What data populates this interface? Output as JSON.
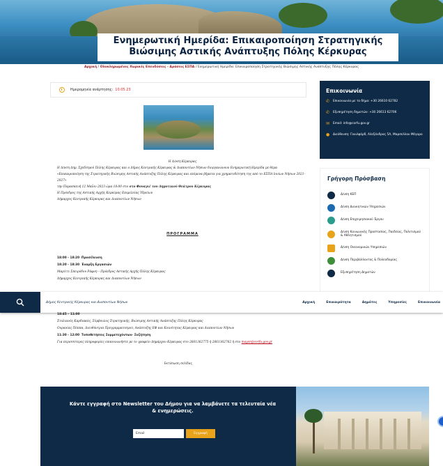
{
  "page": {
    "title": "Ενημερωτική Ημερίδα: Επικαιροποίηση Στρατηγικής Βιώσιμης Αστικής Ανάπτυξης Πόλης Κέρκυρας"
  },
  "breadcrumb": {
    "home": "Αρχική",
    "sep": " / ",
    "section": "Ολοκληρωμένες Χωρικές Επενδύσεις - Δράσεις ΕΣΠΑ",
    "current": "Ενημερωτική Ημερίδα: Επικαιροποίηση Στρατηγικής Βιώσιμης Αστικής Ανάπτυξης Πόλης Κέρκυρας"
  },
  "meta": {
    "date_label": "Ημερομηνία ανάρτησης:",
    "date_value": "10.05.23"
  },
  "article": {
    "intro_caption": "Η Δ/νση Κέρκυρας",
    "p1": "Η Δ/νση Δημ. Σχεδ/σμού Πόλης Κέρκυρας και ο Δήμος Κεντρικής Κέρκυρας & Διαποντίων Νήσων διοργανώνουν Ενημερωτική Ημερίδα με θέμα",
    "p2": "«Επικαιροποίηση της Στρατηγικής Βιώσιμης Αστικής Ανάπτυξης Πόλης Κέρκυρας και επόμενα βήματα για χρηματοδότηση της από το ΕΣΠΑ Ιονίων Νήσων 2021-2027»",
    "p3_text": "την Παρασκευή 12 Μαΐου 2023 ώρα 18:00 στο ",
    "p3_bold": "στο Φουαγιέ του Δημοτικού Θεάτρου Κέρκυρας",
    "p4": "Η Πρόεδρος της Αστικής Αρχής Κερκύρας Επιμελείας Υδρείων",
    "p5": "Δήμαρχος Κεντρικής Κέρκυρας και Διαποντίων Νήσων"
  },
  "program": {
    "heading": "ΠΡΟΓΡΑΜΜΑ",
    "items": [
      {
        "time": "18:00 - 18:20",
        "title": "Προσέλευση",
        "detail": ""
      },
      {
        "time": "18:20 - 18:30",
        "title": "Έναρξη Εργασιών",
        "detail": "Μαρίττι Σπειρόδου Ράφνη – Πρόεδρος Αστικής Αρχής Πόλης Κέρκυρας"
      },
      {
        "time": "",
        "title": "",
        "detail": "Δήμαρχος Κεντρικής Κέρκυρας και Διαποντίων Νήσων"
      }
    ],
    "items_after": [
      {
        "time": "18:45 – 11:00",
        "title": "",
        "detail": ""
      },
      {
        "time": "",
        "title": "",
        "detail": "Στυλιανός Καρδιακός, Σύμβουλος Στρατηγικής, Βιώσιμης Αστικής Ανάπτυξης Πόλης Κέρκυρας"
      },
      {
        "time": "",
        "title": "",
        "detail": "Ουρανίας Πόππα, Διευθύντρια Προγραμματισμού, Ανάπτυξης ΕΦ και Κοινότητας Κέρκυρας και Διαποντίων Νήσων"
      },
      {
        "time": "11:30 - 12:00",
        "title": "Τοποθετήσεις Συμμετεχόντων- Συζήτηση",
        "detail": ""
      }
    ],
    "contact_note": "Για περισσότερες πληροφορίες επικοινωνήστε με το γραφείο Δημάρχου Κέρκυρας στο 2661362775 ή 2661362762 ή στο",
    "contact_link": "mayor@corfu.gov.gr",
    "print_label": "Εκτύπωση σελίδας"
  },
  "contact": {
    "heading": "Επικοινωνία",
    "rows": [
      {
        "icon": "phone-icon",
        "text": "Επικοινωνία με το δήμο: +30 26610 62782"
      },
      {
        "icon": "phone-icon",
        "text": "Εξυπηρέτηση δημοτών: +30 26613 62706"
      },
      {
        "icon": "mail-icon",
        "text": "Email: info@corfu.gov.gr"
      },
      {
        "icon": "location-icon",
        "text": "Διεύθυνση: Γουιλφόρδ, Αλεξάνδρας 5Α, Μαρσελλου Μέγαρο"
      }
    ]
  },
  "quick": {
    "heading": "Γρήγορη Πρόσβαση",
    "items": [
      {
        "label": "Δ/νση ΚΕΠ",
        "color": "#0e2a46"
      },
      {
        "label": "Δ/νση Διοικητικών Υπηρεσιών",
        "color": "#1c6bb0"
      },
      {
        "label": "Δ/νση Επιχειρησιακού Έργου",
        "color": "#2a9d8f"
      },
      {
        "label": "Δ/νση Κοινωνικής Προστασίας, Παιδείας, Πολιτισμού & Αθλητισμού",
        "color": "#e8a31b"
      },
      {
        "label": "Δ/νση Οικονομικών Υπηρεσιών",
        "color": "#e8a31b"
      },
      {
        "label": "Δ/νση Περιβάλλοντος & Πολεοδομίας",
        "color": "#3f8f3a"
      },
      {
        "label": "Εξυπηρέτηση Δημοτών",
        "color": "#0e2a46"
      }
    ]
  },
  "nav": {
    "site_title": "Δήμος Κεντρικής Κέρκυρας και Διαποντίων Νήσων",
    "items": [
      "Αρχική",
      "Επικαιρότητα",
      "Δημότες",
      "Υπηρεσίες",
      "Επικοινωνία"
    ]
  },
  "newsletter": {
    "heading": "Κάντε εγγραφή στο Newsletter του Δήμου για να λαμβάνετε τα τελευταία νέα & ενημερώσεις.",
    "email_placeholder": "Email",
    "submit_label": "Εγγραφή"
  },
  "colors": {
    "navy": "#0e2a46",
    "accent": "#e8a31b",
    "link_red": "#9c1b23"
  }
}
